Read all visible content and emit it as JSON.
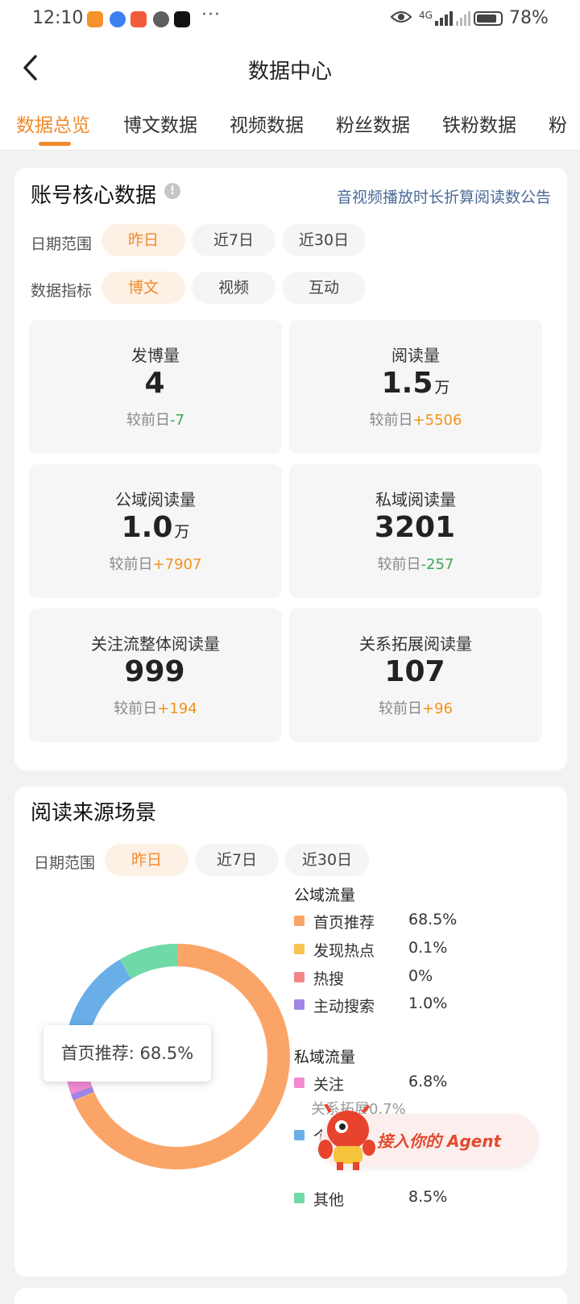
{
  "status_bar": {
    "time": "12:10",
    "dots": "···",
    "network": "4G",
    "battery": "78%"
  },
  "header": {
    "title": "数据中心"
  },
  "tabs": [
    "数据总览",
    "博文数据",
    "视频数据",
    "粉丝数据",
    "铁粉数据",
    "粉"
  ],
  "core": {
    "title": "账号核心数据",
    "info": "!",
    "notice": "音视频播放时长折算阅读数公告",
    "date_label": "日期范围",
    "date_options": [
      "昨日",
      "近7日",
      "近30日"
    ],
    "metric_label": "数据指标",
    "metric_options": [
      "博文",
      "视频",
      "互动"
    ],
    "compare_prefix": "较前日",
    "metrics": [
      {
        "label": "发博量",
        "value": "4",
        "unit": "",
        "delta": "-7"
      },
      {
        "label": "阅读量",
        "value": "1.5",
        "unit": "万",
        "delta": "+5506"
      },
      {
        "label": "公域阅读量",
        "value": "1.0",
        "unit": "万",
        "delta": "+7907"
      },
      {
        "label": "私域阅读量",
        "value": "3201",
        "unit": "",
        "delta": "-257"
      },
      {
        "label": "关注流整体阅读量",
        "value": "999",
        "unit": "",
        "delta": "+194"
      },
      {
        "label": "关系拓展阅读量",
        "value": "107",
        "unit": "",
        "delta": "+96"
      }
    ]
  },
  "source": {
    "title": "阅读来源场景",
    "date_label": "日期范围",
    "date_options": [
      "昨日",
      "近7日",
      "近30日"
    ],
    "tooltip": "首页推荐: 68.5%",
    "public_title": "公域流量",
    "private_title": "私域流量",
    "public_items": [
      {
        "name": "首页推荐",
        "value": "68.5%",
        "color": "#fba468"
      },
      {
        "name": "发现热点",
        "value": "0.1%",
        "color": "#f6c44f"
      },
      {
        "name": "热搜",
        "value": "0%",
        "color": "#f28686"
      },
      {
        "name": "主动搜索",
        "value": "1.0%",
        "color": "#a184e6"
      }
    ],
    "private_items": [
      {
        "name": "关注",
        "value": "6.8%",
        "color": "#f28ad2"
      },
      {
        "name": "个",
        "value": "",
        "color": "#6aaee8"
      },
      {
        "name": "其他",
        "value": "8.5%",
        "color": "#6fd9a8"
      }
    ],
    "sub_item": "关系拓展0.7%"
  },
  "chart_data": {
    "type": "pie",
    "categories": [
      "首页推荐",
      "发现热点",
      "热搜",
      "主动搜索",
      "关注",
      "个",
      "其他"
    ],
    "values": [
      68.5,
      0.1,
      0,
      1.0,
      6.8,
      15.1,
      8.5
    ],
    "colors": [
      "#fba468",
      "#f6c44f",
      "#f28686",
      "#a184e6",
      "#f28ad2",
      "#6aaee8",
      "#6fd9a8"
    ]
  },
  "agent": {
    "text": "接入你的 Agent"
  }
}
